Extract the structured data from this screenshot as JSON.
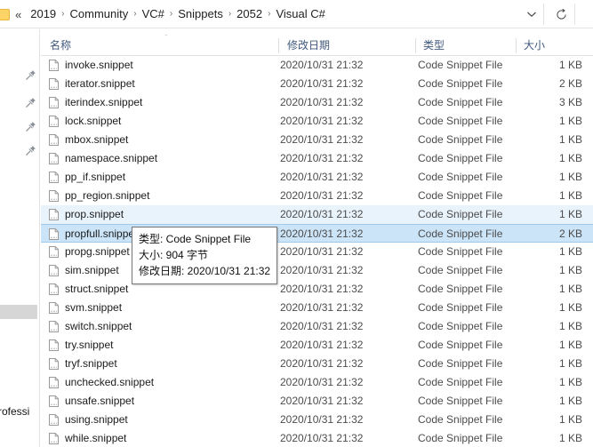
{
  "addressbar": {
    "overflow_chevrons": "«",
    "separator": "›",
    "crumbs": [
      "2019",
      "Community",
      "VC#",
      "Snippets",
      "2052",
      "Visual C#"
    ],
    "dropdown_icon": "chevron-down",
    "refresh_icon": "refresh"
  },
  "left_rail": {
    "pin_icon": "pin",
    "pin_count": 4,
    "partial_text": "rofessi"
  },
  "columns": {
    "name": "名称",
    "date_modified": "修改日期",
    "type": "类型",
    "size": "大小",
    "sort_caret": "˄"
  },
  "files": [
    {
      "name": "invoke.snippet",
      "date": "2020/10/31 21:32",
      "type": "Code Snippet File",
      "size": "1 KB",
      "state": "normal"
    },
    {
      "name": "iterator.snippet",
      "date": "2020/10/31 21:32",
      "type": "Code Snippet File",
      "size": "2 KB",
      "state": "normal"
    },
    {
      "name": "iterindex.snippet",
      "date": "2020/10/31 21:32",
      "type": "Code Snippet File",
      "size": "3 KB",
      "state": "normal"
    },
    {
      "name": "lock.snippet",
      "date": "2020/10/31 21:32",
      "type": "Code Snippet File",
      "size": "1 KB",
      "state": "normal"
    },
    {
      "name": "mbox.snippet",
      "date": "2020/10/31 21:32",
      "type": "Code Snippet File",
      "size": "1 KB",
      "state": "normal"
    },
    {
      "name": "namespace.snippet",
      "date": "2020/10/31 21:32",
      "type": "Code Snippet File",
      "size": "1 KB",
      "state": "normal"
    },
    {
      "name": "pp_if.snippet",
      "date": "2020/10/31 21:32",
      "type": "Code Snippet File",
      "size": "1 KB",
      "state": "normal"
    },
    {
      "name": "pp_region.snippet",
      "date": "2020/10/31 21:32",
      "type": "Code Snippet File",
      "size": "1 KB",
      "state": "normal"
    },
    {
      "name": "prop.snippet",
      "date": "2020/10/31 21:32",
      "type": "Code Snippet File",
      "size": "1 KB",
      "state": "selected"
    },
    {
      "name": "propfull.snippet",
      "date": "2020/10/31 21:32",
      "type": "Code Snippet File",
      "size": "2 KB",
      "state": "focused"
    },
    {
      "name": "propg.snippet",
      "date": "2020/10/31 21:32",
      "type": "Code Snippet File",
      "size": "1 KB",
      "state": "normal"
    },
    {
      "name": "sim.snippet",
      "date": "2020/10/31 21:32",
      "type": "Code Snippet File",
      "size": "1 KB",
      "state": "normal"
    },
    {
      "name": "struct.snippet",
      "date": "2020/10/31 21:32",
      "type": "Code Snippet File",
      "size": "1 KB",
      "state": "normal"
    },
    {
      "name": "svm.snippet",
      "date": "2020/10/31 21:32",
      "type": "Code Snippet File",
      "size": "1 KB",
      "state": "normal"
    },
    {
      "name": "switch.snippet",
      "date": "2020/10/31 21:32",
      "type": "Code Snippet File",
      "size": "1 KB",
      "state": "normal"
    },
    {
      "name": "try.snippet",
      "date": "2020/10/31 21:32",
      "type": "Code Snippet File",
      "size": "1 KB",
      "state": "normal"
    },
    {
      "name": "tryf.snippet",
      "date": "2020/10/31 21:32",
      "type": "Code Snippet File",
      "size": "1 KB",
      "state": "normal"
    },
    {
      "name": "unchecked.snippet",
      "date": "2020/10/31 21:32",
      "type": "Code Snippet File",
      "size": "1 KB",
      "state": "normal"
    },
    {
      "name": "unsafe.snippet",
      "date": "2020/10/31 21:32",
      "type": "Code Snippet File",
      "size": "1 KB",
      "state": "normal"
    },
    {
      "name": "using.snippet",
      "date": "2020/10/31 21:32",
      "type": "Code Snippet File",
      "size": "1 KB",
      "state": "normal"
    },
    {
      "name": "while.snippet",
      "date": "2020/10/31 21:32",
      "type": "Code Snippet File",
      "size": "1 KB",
      "state": "normal"
    }
  ],
  "tooltip": {
    "lines": [
      "类型: Code Snippet File",
      "大小: 904 字节",
      "修改日期: 2020/10/31 21:32"
    ]
  },
  "colors": {
    "selection_light": "#e9f3fc",
    "selection_strong": "#cce4f7",
    "selection_border": "#9cc9ec",
    "header_text": "#41597c",
    "folder_yellow": "#ffd466"
  }
}
